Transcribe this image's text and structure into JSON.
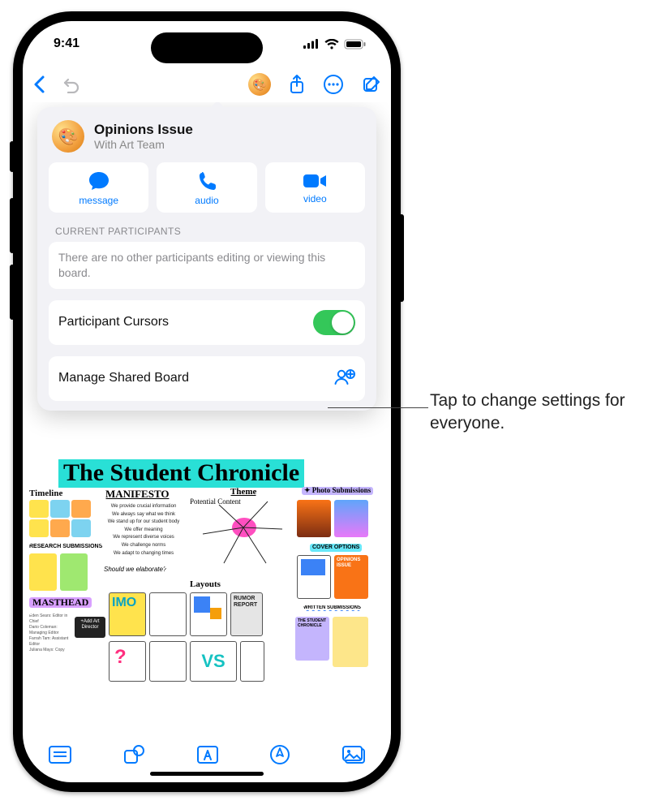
{
  "status": {
    "time": "9:41"
  },
  "popover": {
    "title": "Opinions Issue",
    "subtitle": "With Art Team",
    "actions": {
      "message": "message",
      "audio": "audio",
      "video": "video"
    },
    "participants_header": "CURRENT PARTICIPANTS",
    "participants_text": "There are no other participants editing or viewing this board.",
    "cursors_label": "Participant Cursors",
    "cursors_on": true,
    "manage_label": "Manage Shared Board"
  },
  "board": {
    "title": "The Student Chronicle",
    "labels": {
      "timeline": "Timeline",
      "manifesto": "MANIFESTO",
      "theme": "Theme",
      "photo": "Photo Submissions",
      "research": "RESEARCH SUBMISSIONS",
      "masthead": "MASTHEAD",
      "layouts": "Layouts",
      "cover": "COVER OPTIONS",
      "written": "WRITTEN SUBMISSIONS",
      "potential": "Potential Content",
      "rumor": "RUMOR REPORT",
      "imo": "IMO",
      "vs": "VS",
      "elaborate": "Should we elaborate?",
      "add_art": "+Add Art Director",
      "chronicle_small": "THE STUDENT CHRONICLE",
      "opinions_cover": "OPINIONS ISSUE"
    },
    "manifesto_lines": [
      "We provide crucial information",
      "We always say what we think",
      "We stand up for our student body",
      "We offer meaning",
      "We represent diverse voices",
      "We challenge norms",
      "We adapt to changing times"
    ]
  },
  "callout": "Tap to change settings for everyone."
}
